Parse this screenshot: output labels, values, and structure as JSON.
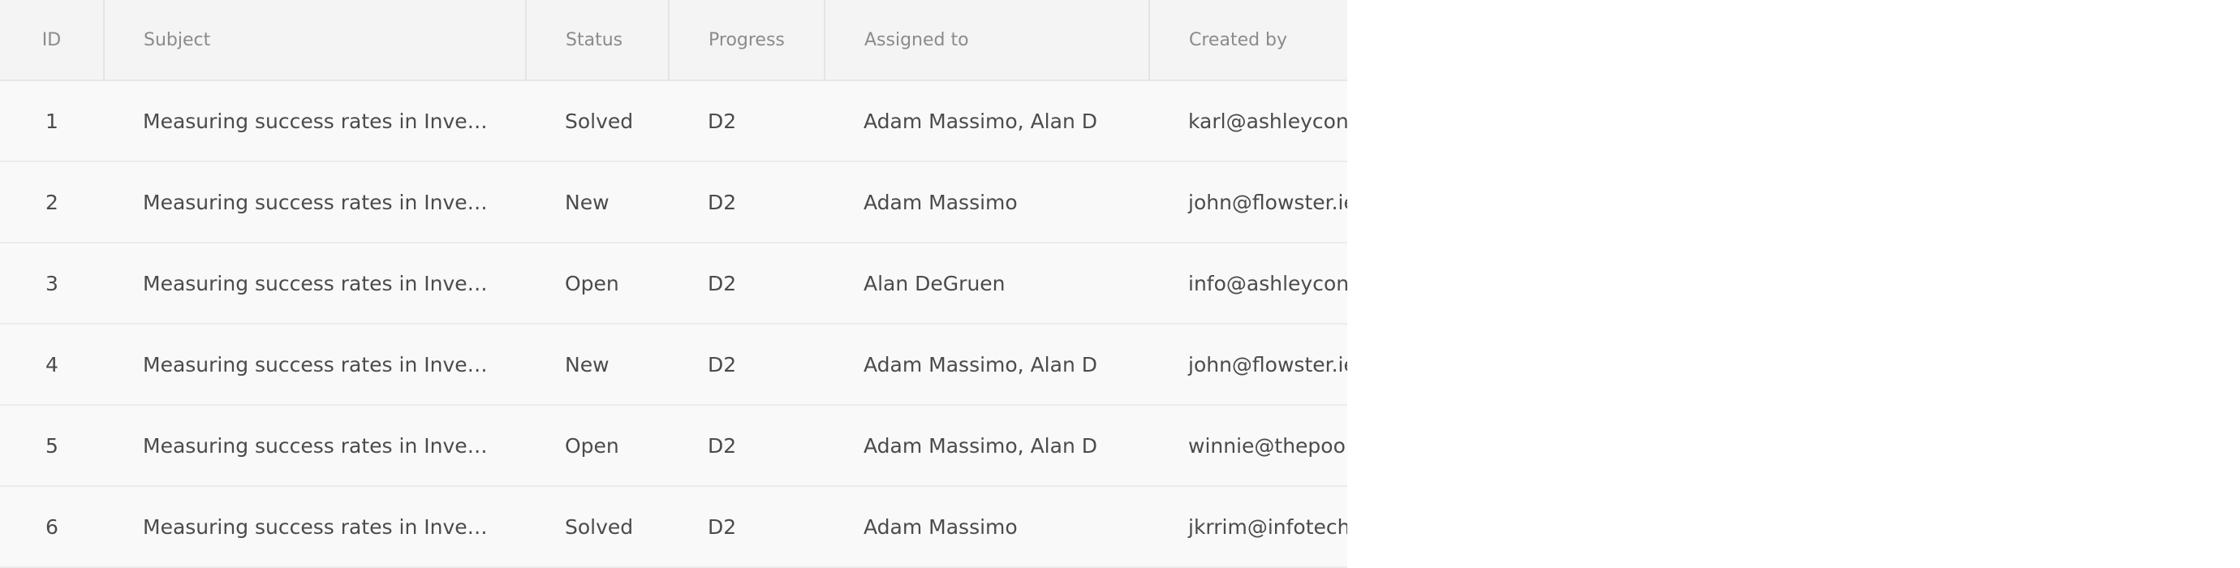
{
  "table": {
    "headers": {
      "id": "ID",
      "subject": "Subject",
      "status": "Status",
      "progress": "Progress",
      "assigned_to": "Assigned to",
      "created_by": "Created by"
    },
    "rows": [
      {
        "id": "1",
        "subject": "Measuring success rates in Investigations",
        "status": "Solved",
        "progress": "D2",
        "assigned_to": "Adam Massimo, Alan D",
        "created_by": "karl@ashleyconsulting.ie"
      },
      {
        "id": "2",
        "subject": "Measuring success rates in Investigations",
        "status": "New",
        "progress": "D2",
        "assigned_to": "Adam Massimo",
        "created_by": "john@flowster.ie"
      },
      {
        "id": "3",
        "subject": "Measuring success rates in Investigations",
        "status": "Open",
        "progress": "D2",
        "assigned_to": "Alan DeGruen",
        "created_by": "info@ashleyconsulting.ie"
      },
      {
        "id": "4",
        "subject": "Measuring success rates in Investigations",
        "status": "New",
        "progress": "D2",
        "assigned_to": "Adam Massimo, Alan D",
        "created_by": "john@flowster.ie"
      },
      {
        "id": "5",
        "subject": "Measuring success rates in Investigations",
        "status": "Open",
        "progress": "D2",
        "assigned_to": "Adam Massimo, Alan D",
        "created_by": "winnie@thepoohcorner.ie"
      },
      {
        "id": "6",
        "subject": "Measuring success rates in Investigations",
        "status": "Solved",
        "progress": "D2",
        "assigned_to": "Adam Massimo",
        "created_by": "jkrrim@infotech.com"
      }
    ]
  },
  "colors": {
    "header_background": "#f4f4f4",
    "row_background": "#f9f9f9",
    "header_text": "#8b8b8b",
    "cell_text": "#4b4b4b",
    "page_background": "#ffffff"
  }
}
